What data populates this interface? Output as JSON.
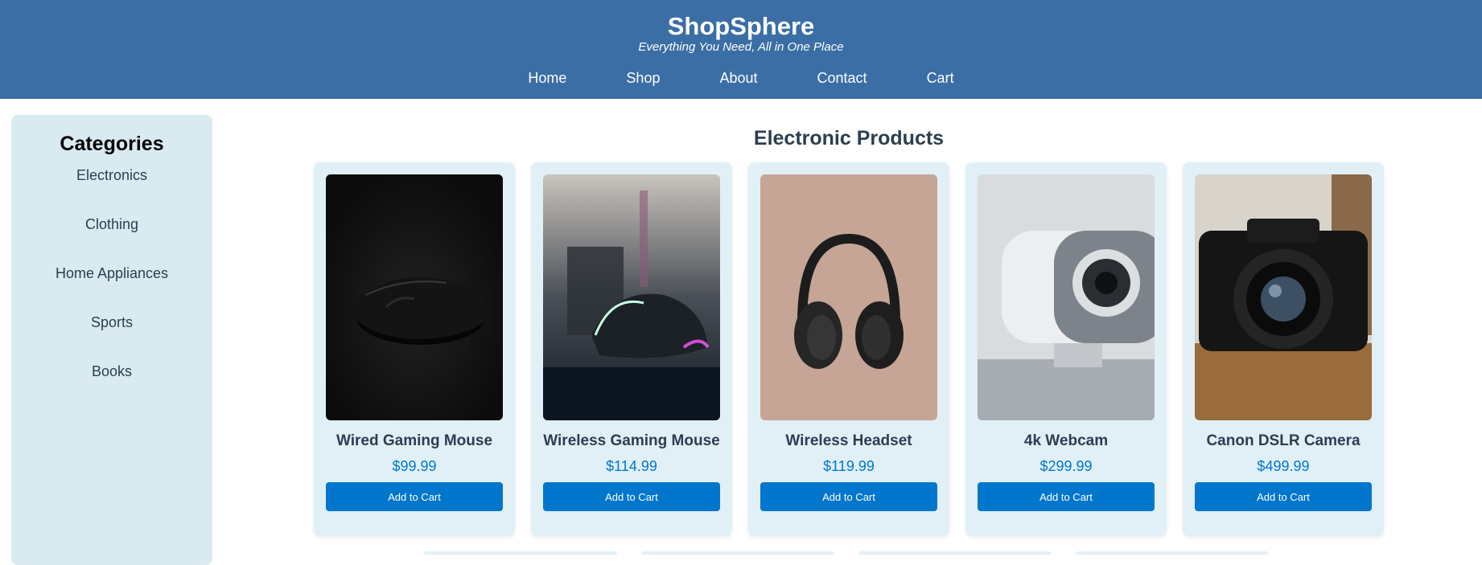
{
  "header": {
    "title": "ShopSphere",
    "tagline": "Everything You Need, All in One Place",
    "nav": [
      "Home",
      "Shop",
      "About",
      "Contact",
      "Cart"
    ]
  },
  "sidebar": {
    "heading": "Categories",
    "items": [
      "Electronics",
      "Clothing",
      "Home Appliances",
      "Sports",
      "Books"
    ]
  },
  "main": {
    "title": "Electronic Products",
    "products": [
      {
        "name": "Wired Gaming Mouse",
        "price": "$99.99",
        "button": "Add to Cart",
        "image": "black-mouse-photo"
      },
      {
        "name": "Wireless Gaming Mouse",
        "price": "$114.99",
        "button": "Add to Cart",
        "image": "rgb-mouse-photo"
      },
      {
        "name": "Wireless Headset",
        "price": "$119.99",
        "button": "Add to Cart",
        "image": "headphones-photo"
      },
      {
        "name": "4k Webcam",
        "price": "$299.99",
        "button": "Add to Cart",
        "image": "webcam-photo"
      },
      {
        "name": "Canon DSLR Camera",
        "price": "$499.99",
        "button": "Add to Cart",
        "image": "camera-photo"
      }
    ]
  },
  "colors": {
    "header_bg": "#3a6ea5",
    "sidebar_bg": "#daeaf1",
    "card_bg": "#e1f0f7",
    "accent": "#0077cc",
    "heading_text": "#2c3e50"
  }
}
